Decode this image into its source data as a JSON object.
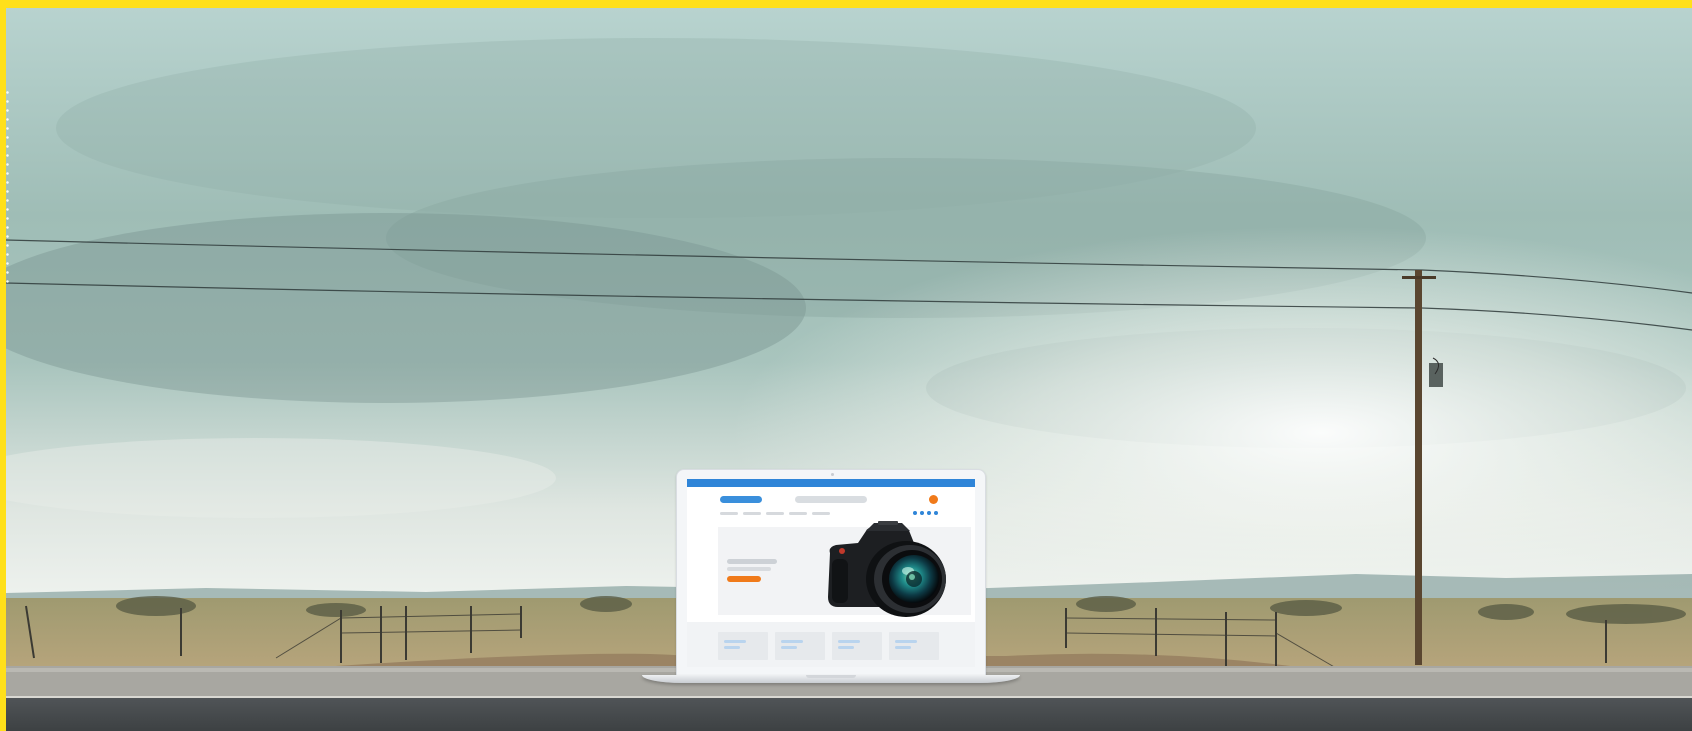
{
  "page": {
    "frame_color": "#ffe01a",
    "sky_color": "#a9c6c0",
    "road_color": "#45494c"
  },
  "laptop": {
    "screen": {
      "topbar_color": "#2f85d8",
      "accent_color": "#f07a1a",
      "cart_badge": "",
      "hero_image": "dslr-camera-icon"
    }
  }
}
